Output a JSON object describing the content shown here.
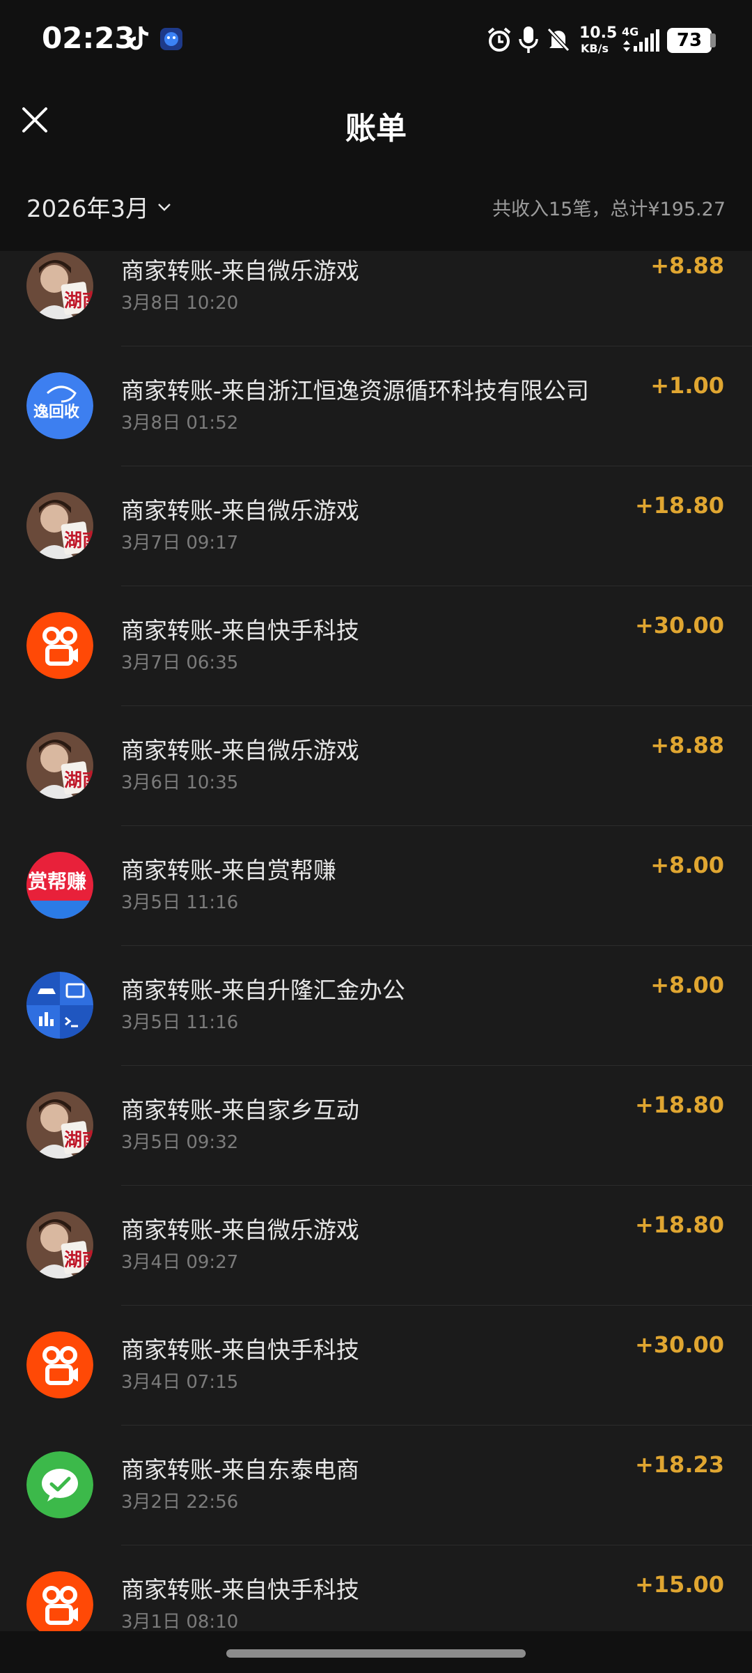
{
  "status_bar": {
    "time": "02:23",
    "net_speed_value": "10.5",
    "net_speed_unit": "KB/s",
    "network_type": "4G",
    "battery": "73"
  },
  "header": {
    "title": "账单"
  },
  "filter": {
    "month": "2026年3月",
    "summary": "共收入15笔，总计¥195.27"
  },
  "transactions": [
    {
      "title": "商家转账-来自微乐游戏",
      "date": "3月8日 10:20",
      "amount": "+8.88",
      "icon": "weile-game-avatar-icon"
    },
    {
      "title": "商家转账-来自浙江恒逸资源循环科技有限公司",
      "date": "3月8日 01:52",
      "amount": "+1.00",
      "icon": "yihuishou-logo-icon",
      "logo_text": "逸回收"
    },
    {
      "title": "商家转账-来自微乐游戏",
      "date": "3月7日 09:17",
      "amount": "+18.80",
      "icon": "weile-game-avatar-icon"
    },
    {
      "title": "商家转账-来自快手科技",
      "date": "3月7日 06:35",
      "amount": "+30.00",
      "icon": "kuaishou-logo-icon"
    },
    {
      "title": "商家转账-来自微乐游戏",
      "date": "3月6日 10:35",
      "amount": "+8.88",
      "icon": "weile-game-avatar-icon"
    },
    {
      "title": "商家转账-来自赏帮赚",
      "date": "3月5日 11:16",
      "amount": "+8.00",
      "icon": "shangbangzhuan-logo-icon",
      "logo_text": "赏帮赚"
    },
    {
      "title": "商家转账-来自升隆汇金办公",
      "date": "3月5日 11:16",
      "amount": "+8.00",
      "icon": "office-app-logo-icon"
    },
    {
      "title": "商家转账-来自家乡互动",
      "date": "3月5日 09:32",
      "amount": "+18.80",
      "icon": "weile-game-avatar-icon"
    },
    {
      "title": "商家转账-来自微乐游戏",
      "date": "3月4日 09:27",
      "amount": "+18.80",
      "icon": "weile-game-avatar-icon"
    },
    {
      "title": "商家转账-来自快手科技",
      "date": "3月4日 07:15",
      "amount": "+30.00",
      "icon": "kuaishou-logo-icon"
    },
    {
      "title": "商家转账-来自东泰电商",
      "date": "3月2日 22:56",
      "amount": "+18.23",
      "icon": "wechat-logo-icon"
    },
    {
      "title": "商家转账-来自快手科技",
      "date": "3月1日 08:10",
      "amount": "+15.00",
      "icon": "kuaishou-logo-icon"
    }
  ],
  "avatar_tile_text": "湖南",
  "colors": {
    "background": "#111111",
    "list_background": "#1b1b1b",
    "amount": "#e0a631",
    "kuaishou": "#ff4906",
    "yihuishou": "#3d7ff0",
    "wechat": "#3cb94a",
    "shangbangzhuan": "#e8213a"
  }
}
